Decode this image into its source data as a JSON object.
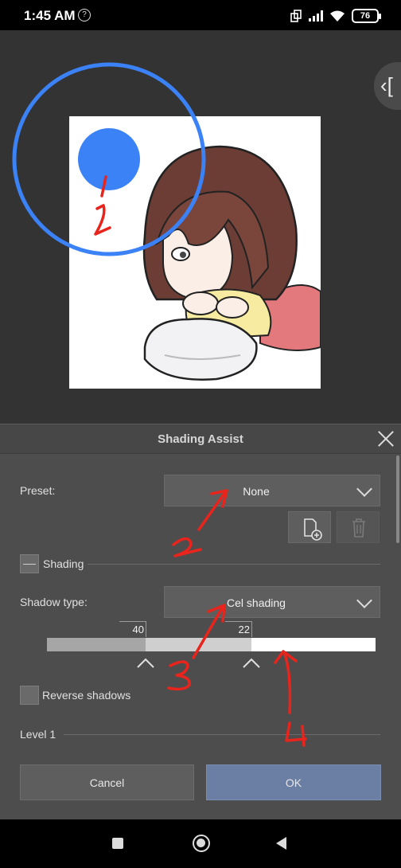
{
  "status_bar": {
    "time": "1:45 AM",
    "battery": "76"
  },
  "panel": {
    "title": "Shading Assist",
    "preset_label": "Preset:",
    "preset_value": "None",
    "shading_label": "Shading",
    "shadow_type_label": "Shadow type:",
    "shadow_type_value": "Cel shading",
    "slider_values": [
      "40",
      "22"
    ],
    "slider_colors": [
      "#a6a6a6",
      "#cfcfcf",
      "#ffffff"
    ],
    "reverse_shadows_label": "Reverse shadows",
    "level_label": "Level 1",
    "cancel_label": "Cancel",
    "ok_label": "OK"
  },
  "annotations": {
    "color": "#e8241c",
    "brush_circle_color": "#3b82f6",
    "numbers": [
      "1",
      "2",
      "3",
      "4"
    ]
  }
}
